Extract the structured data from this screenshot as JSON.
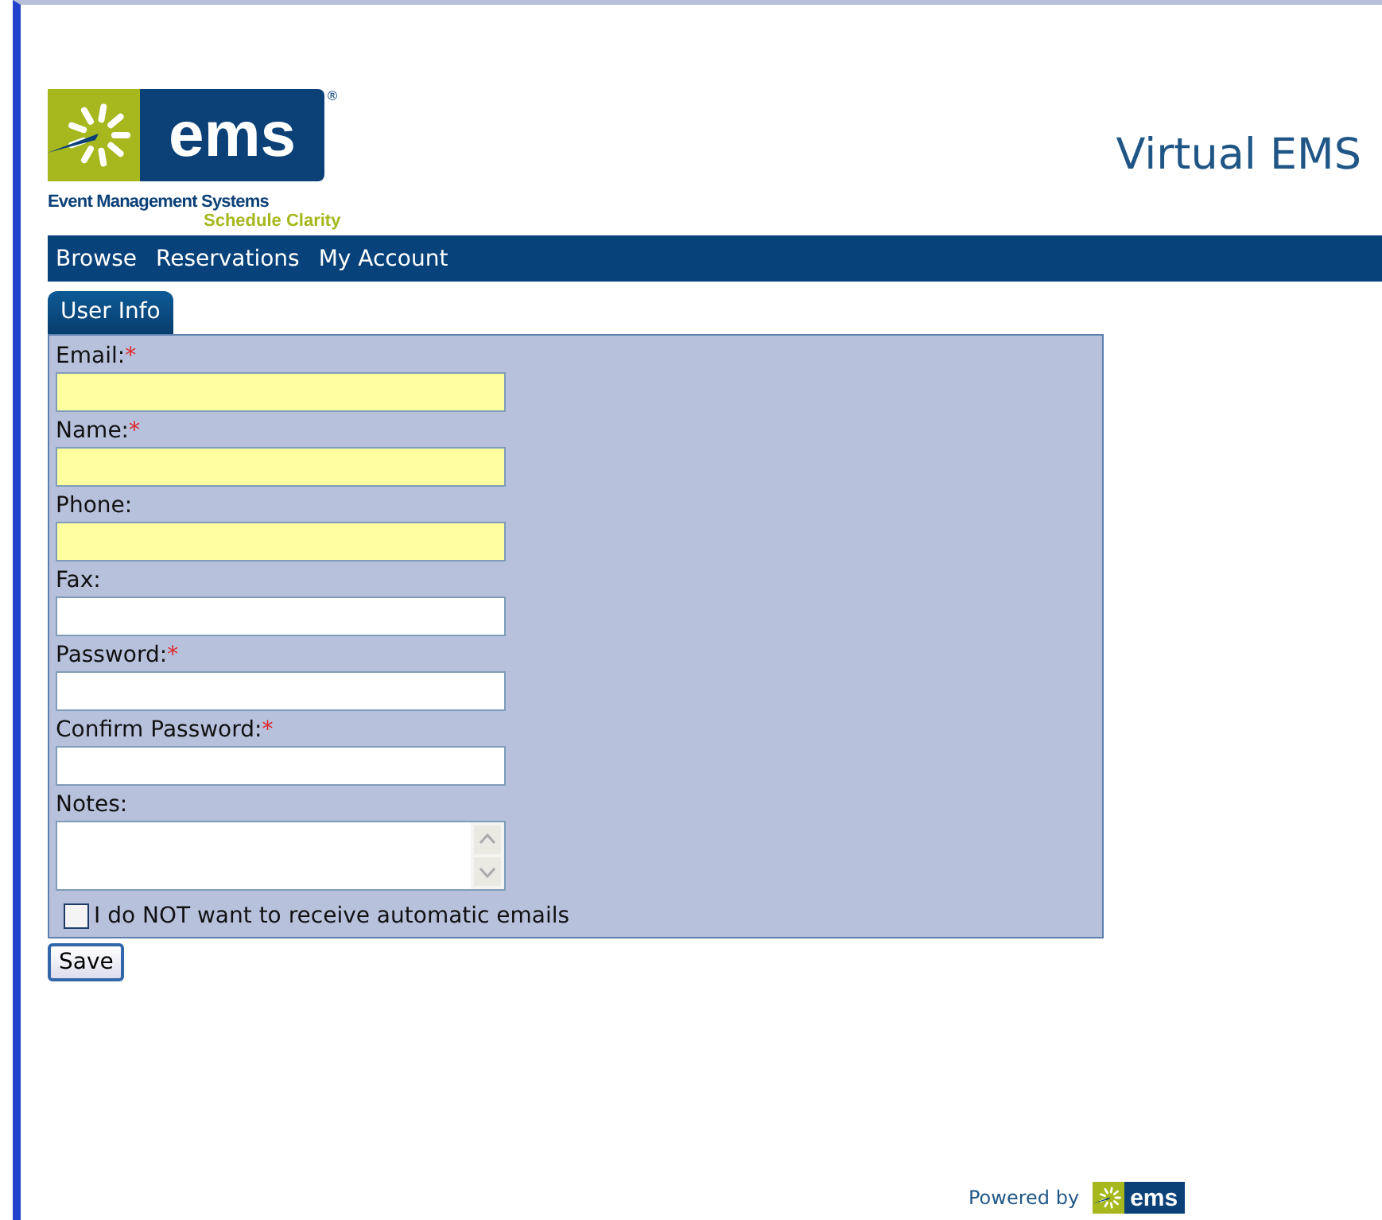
{
  "logo": {
    "wordmark": "ems",
    "registered": "®",
    "company": "Event Management Systems",
    "tagline": "Schedule Clarity"
  },
  "app_title": "Virtual EMS",
  "nav": [
    {
      "label": "Browse"
    },
    {
      "label": "Reservations"
    },
    {
      "label": "My Account"
    }
  ],
  "tabs": [
    {
      "label": "User Info",
      "selected": true
    }
  ],
  "fields": [
    {
      "label": "Email:",
      "required_mark": "*",
      "highlighted": true,
      "kind": "text"
    },
    {
      "label": "Name:",
      "required_mark": "*",
      "highlighted": true,
      "kind": "text"
    },
    {
      "label": "Phone:",
      "highlighted": true,
      "kind": "text"
    },
    {
      "label": "Fax:",
      "highlighted": false,
      "kind": "text"
    },
    {
      "label": "Password:",
      "required_mark": "*",
      "highlighted": false,
      "kind": "text"
    },
    {
      "label": "Confirm Password:",
      "required_mark": "*",
      "highlighted": false,
      "kind": "text"
    },
    {
      "label": "Notes:",
      "highlighted": false,
      "kind": "textarea"
    }
  ],
  "opt_out": {
    "label": "I do NOT want to receive automatic emails",
    "checked": false
  },
  "save_button": "Save",
  "footer": {
    "powered_by": "Powered by",
    "wordmark": "ems"
  }
}
